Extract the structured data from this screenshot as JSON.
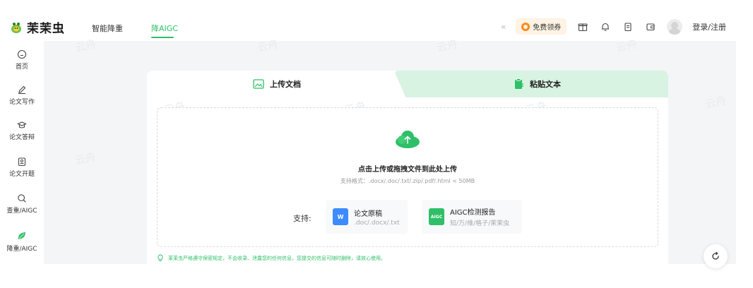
{
  "app": {
    "name": "茉茉虫"
  },
  "nav": [
    {
      "label": "智能降重",
      "active": false
    },
    {
      "label": "降AIGC",
      "active": true
    }
  ],
  "header": {
    "coupon_label": "免费领券",
    "login_label": "登录/注册",
    "icons": [
      "gift-icon",
      "bell-icon",
      "clipboard-icon",
      "wallet-icon"
    ]
  },
  "sidebar": [
    {
      "label": "首页",
      "icon": "home-icon"
    },
    {
      "label": "论文写作",
      "icon": "pen-icon"
    },
    {
      "label": "论文答辩",
      "icon": "graduation-cap-icon"
    },
    {
      "label": "论文开题",
      "icon": "document-icon"
    },
    {
      "label": "查重/AIGC",
      "icon": "search-icon"
    },
    {
      "label": "降重/AIGC",
      "icon": "leaf-icon",
      "active": true
    }
  ],
  "tabs": {
    "upload": "上传文档",
    "paste": "粘贴文本"
  },
  "dropzone": {
    "title": "点击上传或拖拽文件到此处上传",
    "subtitle": "支持格式：.docx/.doc/.txt/.zip/.pdf/.html < 50MB"
  },
  "support": {
    "label": "支持:",
    "cards": [
      {
        "title": "论文原稿",
        "subtitle": ".doc/.docx/.txt",
        "icon_text": "W"
      },
      {
        "title": "AIGC检测报告",
        "subtitle": "知/万/维/格子/茉茉虫",
        "icon_text": "AIGC"
      }
    ]
  },
  "notice": "茉茉虫严格遵守保密规定，不会收录、泄露您的任何信息，您提交的信息可随时删除，请放心使用。",
  "watermark": "云舟",
  "colors": {
    "accent": "#2fbf68",
    "tab_inactive_bg": "#d9f3e2",
    "coupon": "#ff8a1e",
    "word_blue": "#3d8bff"
  }
}
